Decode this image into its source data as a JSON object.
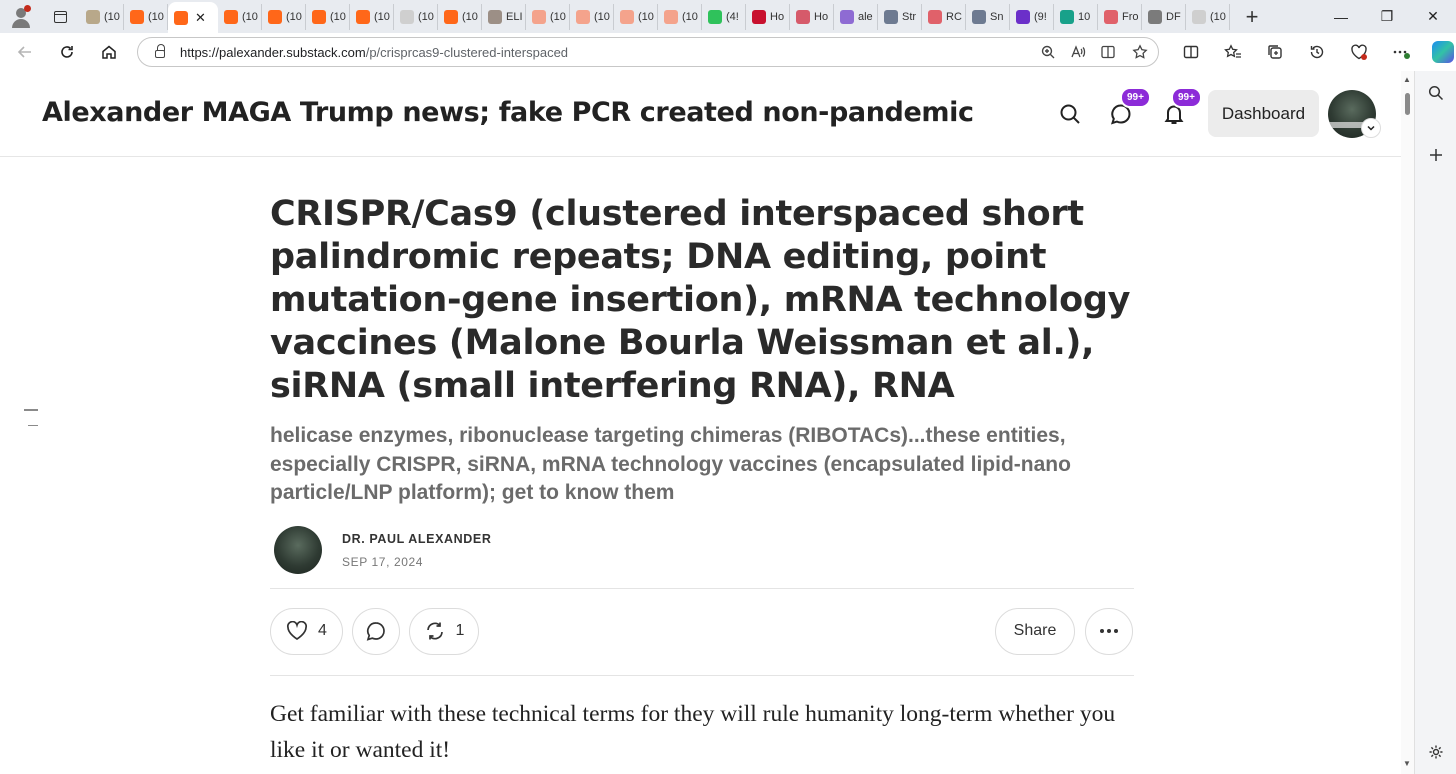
{
  "browser": {
    "tabs": [
      {
        "label": "(10",
        "color": "#b8a88a"
      },
      {
        "label": "(10",
        "color": "#ff6719"
      },
      {
        "label": "",
        "color": "#ff6719",
        "active": true
      },
      {
        "label": "(10",
        "color": "#ff6719"
      },
      {
        "label": "(10",
        "color": "#ff6719"
      },
      {
        "label": "(10",
        "color": "#ff6719"
      },
      {
        "label": "(10",
        "color": "#ff6719"
      },
      {
        "label": "(10",
        "color": "#cfcfcf"
      },
      {
        "label": "(10",
        "color": "#ff6719"
      },
      {
        "label": "ELI",
        "color": "#9c8f86"
      },
      {
        "label": "(10",
        "color": "#f4a38c"
      },
      {
        "label": "(10",
        "color": "#f4a38c"
      },
      {
        "label": "(10",
        "color": "#f4a38c"
      },
      {
        "label": "(10",
        "color": "#f4a38c"
      },
      {
        "label": "(4!",
        "color": "#2fc25b"
      },
      {
        "label": "Ho",
        "color": "#c8102e"
      },
      {
        "label": "Ho",
        "color": "#d65a6a"
      },
      {
        "label": "ale",
        "color": "#8e6bd3"
      },
      {
        "label": "Str",
        "color": "#6d7a91"
      },
      {
        "label": "RC",
        "color": "#e0616a"
      },
      {
        "label": "Sn",
        "color": "#6d7a91"
      },
      {
        "label": "(9!",
        "color": "#6b2fc9"
      },
      {
        "label": "10",
        "color": "#18a18a"
      },
      {
        "label": "Fro",
        "color": "#e0616a"
      },
      {
        "label": "DF",
        "color": "#7b7b7b"
      },
      {
        "label": "(10",
        "color": "#cfcfcf"
      }
    ],
    "new_tab_glyph": "+",
    "window_controls": {
      "minimize": "—",
      "restore": "❐",
      "close": "✕"
    },
    "url_host": "https://palexander.substack.com",
    "url_path": "/p/crisprcas9-clustered-interspaced"
  },
  "header": {
    "publication_title": "Alexander MAGA Trump news; fake PCR created non-pandemic",
    "chat_badge": "99+",
    "notifications_badge": "99+",
    "dashboard_label": "Dashboard"
  },
  "article": {
    "title": "CRISPR/Cas9 (clustered interspaced short palindromic repeats; DNA editing, point mutation-gene insertion), mRNA technology vaccines (Malone Bourla Weissman et al.), siRNA (small interfering RNA), RNA",
    "subtitle": "helicase enzymes, ribonuclease targeting chimeras (RIBOTACs)...these entities, especially CRISPR, siRNA, mRNA technology vaccines (encapsulated lipid-nano particle/LNP platform); get to know them",
    "author": "DR. PAUL ALEXANDER",
    "date": "SEP 17, 2024",
    "likes": "4",
    "restacks": "1",
    "share_label": "Share",
    "body_first_paragraph": "Get familiar with these technical terms for they will rule humanity long-term whether you like it or wanted it!"
  }
}
